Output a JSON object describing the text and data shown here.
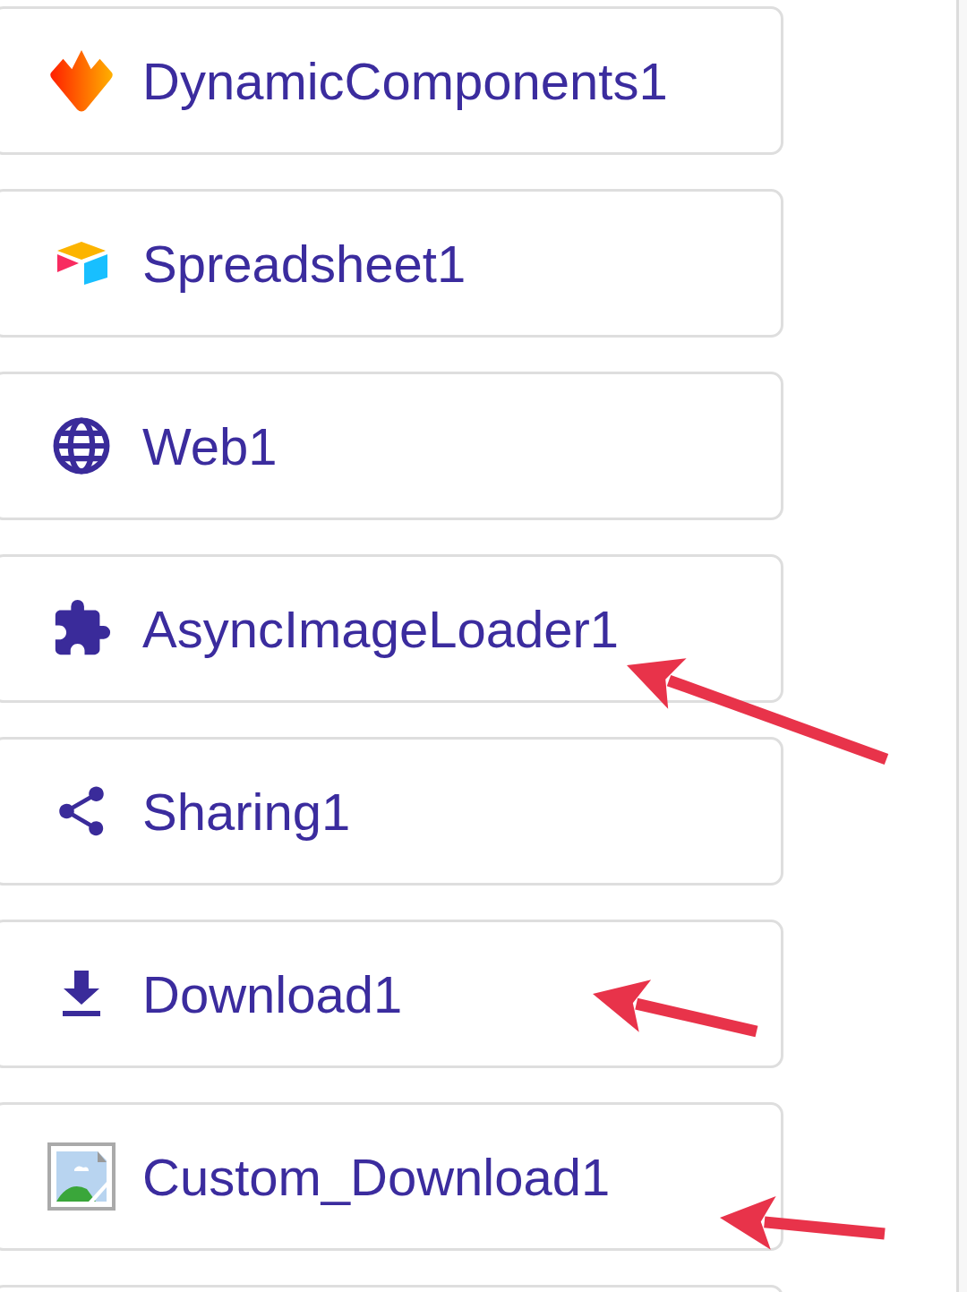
{
  "components": [
    {
      "kind": "flame",
      "name": "DynamicComponents1",
      "marked": false
    },
    {
      "kind": "cube",
      "name": "Spreadsheet1",
      "marked": false
    },
    {
      "kind": "globe",
      "name": "Web1",
      "marked": false
    },
    {
      "kind": "puzzle",
      "name": "AsyncImageLoader1",
      "marked": true
    },
    {
      "kind": "share",
      "name": "Sharing1",
      "marked": false
    },
    {
      "kind": "download",
      "name": "Download1",
      "marked": true
    },
    {
      "kind": "image",
      "name": "Custom_Download1",
      "marked": true
    },
    {
      "kind": "partial"
    }
  ]
}
